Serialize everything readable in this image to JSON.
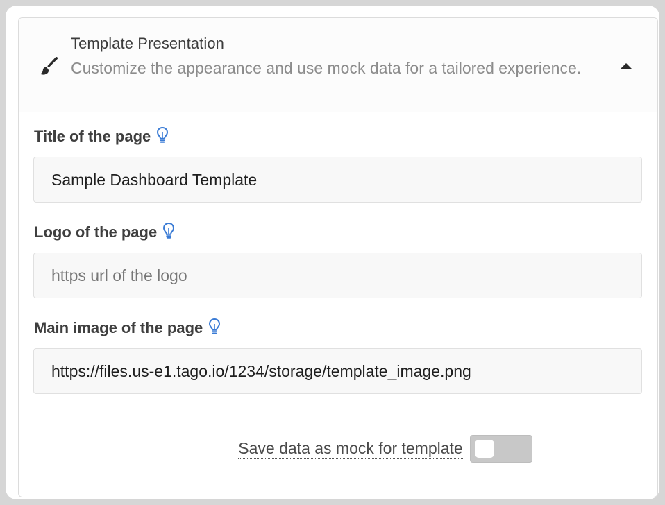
{
  "header": {
    "title": "Template Presentation",
    "description": "Customize the appearance and use mock data for a tailored experience.",
    "icon": "paintbrush-icon",
    "collapse_icon": "chevron-up-icon"
  },
  "fields": {
    "title": {
      "label": "Title of the page",
      "value": "Sample Dashboard Template",
      "placeholder": ""
    },
    "logo": {
      "label": "Logo of the page",
      "value": "",
      "placeholder": "https url of the logo"
    },
    "main_image": {
      "label": "Main image of the page",
      "value": "https://files.us-e1.tago.io/1234/storage/template_image.png",
      "placeholder": ""
    }
  },
  "mock_toggle": {
    "label": "Save data as mock for template",
    "enabled": false
  },
  "colors": {
    "hint_icon": "#3a7bd5",
    "label_text": "#3f3f3f",
    "muted_text": "#8c8c8c",
    "toggle_off": "#c8c8c8"
  }
}
